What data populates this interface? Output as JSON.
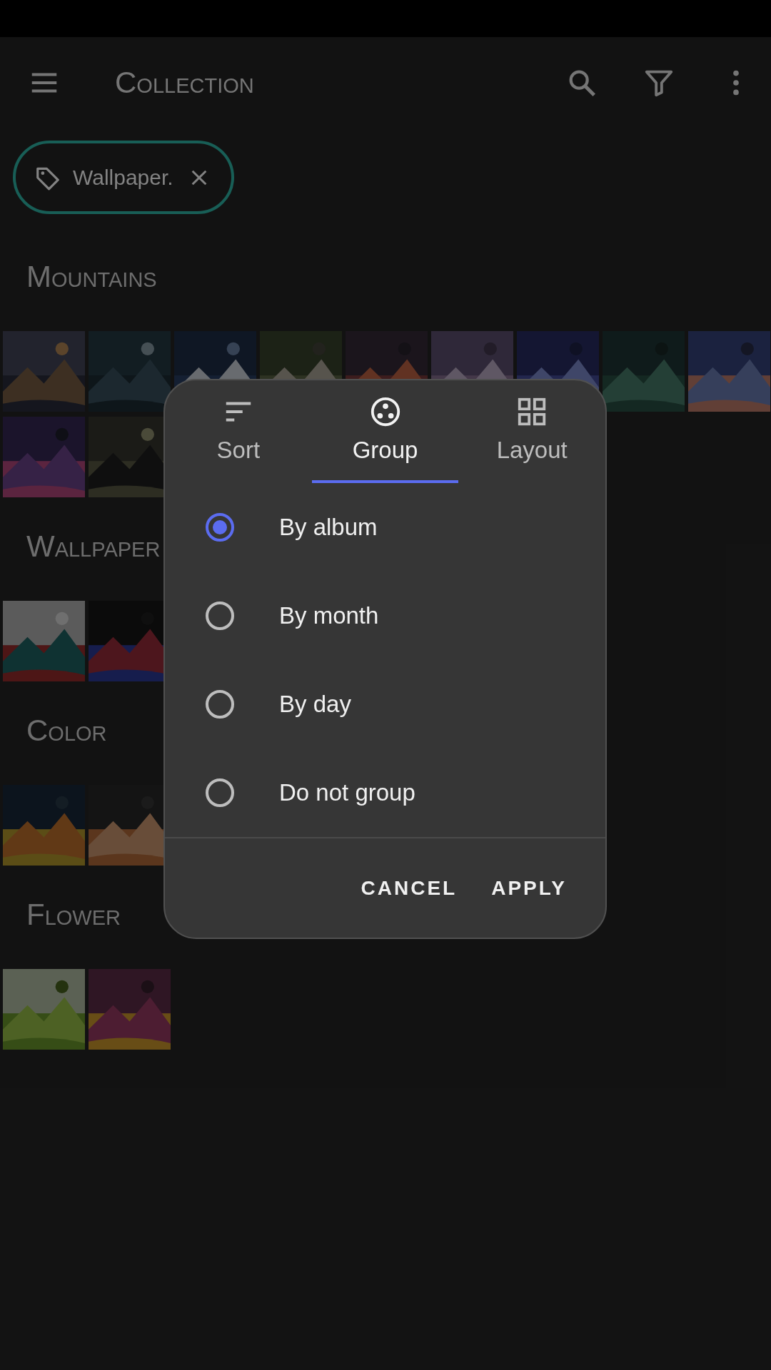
{
  "app_bar": {
    "title": "Collection"
  },
  "filter_chip": {
    "label": "Wallpaper."
  },
  "sections": [
    {
      "title": "Mountains"
    },
    {
      "title": "Wallpaper"
    },
    {
      "title": "Color"
    },
    {
      "title": "Flower"
    }
  ],
  "dialog": {
    "tabs": [
      {
        "kind": "sort",
        "label": "Sort",
        "selected": false
      },
      {
        "kind": "group",
        "label": "Group",
        "selected": true
      },
      {
        "kind": "layout",
        "label": "Layout",
        "selected": false
      }
    ],
    "options": [
      {
        "label": "By album",
        "selected": true
      },
      {
        "label": "By month",
        "selected": false
      },
      {
        "label": "By day",
        "selected": false
      },
      {
        "label": "Do not group",
        "selected": false
      }
    ],
    "buttons": [
      "CANCEL",
      "APPLY"
    ]
  }
}
